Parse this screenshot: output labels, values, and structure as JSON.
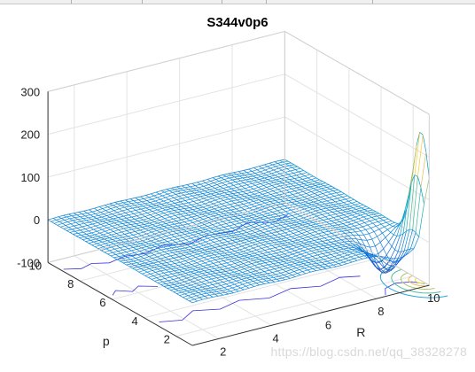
{
  "window": {
    "watermark": "https://blog.csdn.net/qq_38328278"
  },
  "chart_data": {
    "type": "mesh",
    "title": "S344v0p6",
    "xlabel": "R",
    "ylabel": "p",
    "zlabel": "",
    "xlim": [
      1,
      10
    ],
    "ylim": [
      1,
      10
    ],
    "zlim": [
      -100,
      300
    ],
    "xticks": [
      2,
      4,
      6,
      8,
      10
    ],
    "yticks": [
      2,
      4,
      6,
      8,
      10
    ],
    "zticks": [
      -100,
      0,
      100,
      200,
      300
    ],
    "grid": true,
    "colormap": "parula",
    "surface": {
      "baseline": 0,
      "valley": {
        "R": 8.9,
        "p": 2.0,
        "depth": -75
      },
      "peak": {
        "R": 10,
        "p": 1.5,
        "height": 250
      }
    },
    "contour_projection": "floor (z = -100)"
  }
}
